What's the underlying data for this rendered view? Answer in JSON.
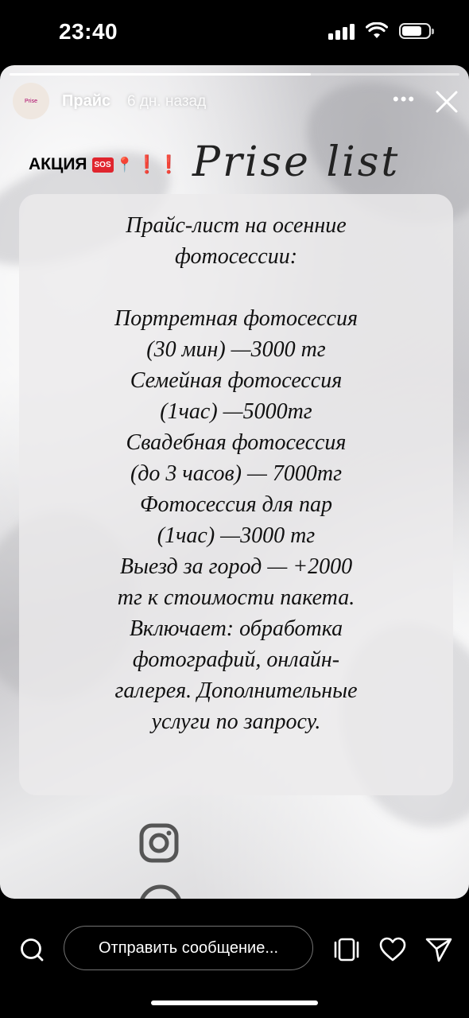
{
  "status_bar": {
    "time": "23:40"
  },
  "story": {
    "progress": 0.67,
    "username": "Прайс",
    "time_ago": "6 дн. назад",
    "avatar_text": "Prise"
  },
  "promo": {
    "label": "АКЦИЯ",
    "sos": "SOS",
    "pin": "📍",
    "exclaim": "❗❗"
  },
  "heading": "Prise list",
  "price_list": {
    "lines": [
      "Прайс-лист на осенние",
      "фотосессии:",
      "",
      "Портретная фотосессия",
      "(30 мин) —3000 тг",
      "Семейная фотосессия",
      "(1час) —5000тг",
      "Свадебная фотосессия",
      "(до 3 часов) — 7000тг",
      "Фотосессия для пар",
      "(1час) —3000 тг",
      "Выезд за город — +2000",
      "тг к стоимости пакета.",
      "Включает: обработка",
      "фотографий, онлайн-",
      "галерея. Дополнительные",
      "услуги по запросу."
    ]
  },
  "bottom_bar": {
    "reply_placeholder": "Отправить сообщение..."
  },
  "colors": {
    "sos_red": "#e0252e",
    "background": "#000000"
  },
  "icons": [
    "search-icon",
    "more-icon",
    "close-icon",
    "instagram-icon",
    "tabs-icon",
    "heart-icon",
    "send-icon"
  ]
}
